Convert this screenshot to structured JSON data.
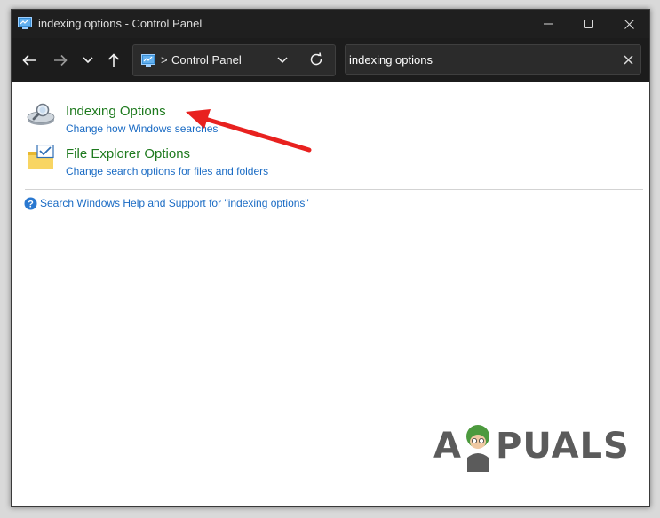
{
  "window": {
    "title": "indexing options - Control Panel",
    "icon": "control-panel-icon"
  },
  "nav": {
    "breadcrumb_separator": ">",
    "breadcrumb": "Control Panel"
  },
  "search": {
    "value": "indexing options"
  },
  "results": [
    {
      "title": "Indexing Options",
      "subtitle": "Change how Windows searches",
      "icon": "indexing-options-icon"
    },
    {
      "title": "File Explorer Options",
      "subtitle": "Change search options for files and folders",
      "icon": "file-explorer-options-icon"
    }
  ],
  "help": {
    "text": "Search Windows Help and Support for \"indexing options\""
  },
  "annotation": {
    "arrow_color": "#e8211f"
  },
  "watermark": {
    "text_left": "A",
    "text_right": "PUALS"
  },
  "colors": {
    "titlebar_bg": "#1f1f1f",
    "link_green": "#1e7a1e",
    "link_blue": "#1a6bc4"
  }
}
